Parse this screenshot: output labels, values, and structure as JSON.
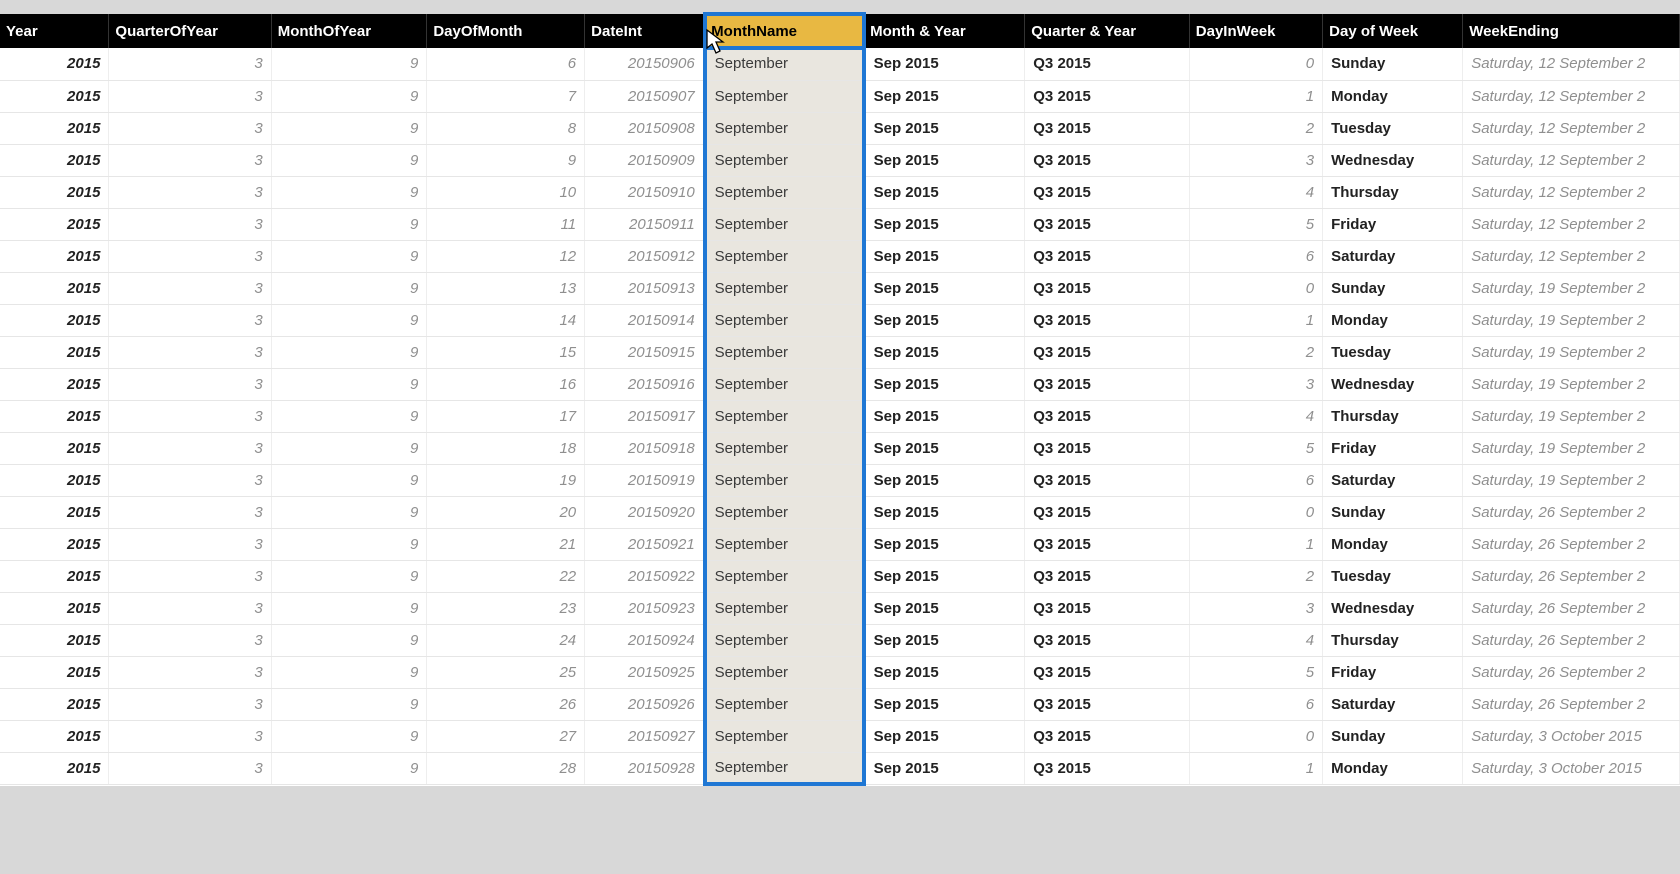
{
  "columns": [
    {
      "key": "year",
      "label": "Year"
    },
    {
      "key": "qoy",
      "label": "QuarterOfYear"
    },
    {
      "key": "moy",
      "label": "MonthOfYear"
    },
    {
      "key": "dom",
      "label": "DayOfMonth"
    },
    {
      "key": "dateint",
      "label": "DateInt"
    },
    {
      "key": "monthname",
      "label": "MonthName"
    },
    {
      "key": "monthyear",
      "label": "Month & Year"
    },
    {
      "key": "qy",
      "label": "Quarter & Year"
    },
    {
      "key": "diw",
      "label": "DayInWeek"
    },
    {
      "key": "dow",
      "label": "Day of Week"
    },
    {
      "key": "weekend",
      "label": "WeekEnding"
    }
  ],
  "selected_column": "monthname",
  "rows": [
    {
      "year": "2015",
      "qoy": "3",
      "moy": "9",
      "dom": "6",
      "dateint": "20150906",
      "monthname": "September",
      "monthyear": "Sep 2015",
      "qy": "Q3 2015",
      "diw": "0",
      "dow": "Sunday",
      "weekend": "Saturday, 12 September 2"
    },
    {
      "year": "2015",
      "qoy": "3",
      "moy": "9",
      "dom": "7",
      "dateint": "20150907",
      "monthname": "September",
      "monthyear": "Sep 2015",
      "qy": "Q3 2015",
      "diw": "1",
      "dow": "Monday",
      "weekend": "Saturday, 12 September 2"
    },
    {
      "year": "2015",
      "qoy": "3",
      "moy": "9",
      "dom": "8",
      "dateint": "20150908",
      "monthname": "September",
      "monthyear": "Sep 2015",
      "qy": "Q3 2015",
      "diw": "2",
      "dow": "Tuesday",
      "weekend": "Saturday, 12 September 2"
    },
    {
      "year": "2015",
      "qoy": "3",
      "moy": "9",
      "dom": "9",
      "dateint": "20150909",
      "monthname": "September",
      "monthyear": "Sep 2015",
      "qy": "Q3 2015",
      "diw": "3",
      "dow": "Wednesday",
      "weekend": "Saturday, 12 September 2"
    },
    {
      "year": "2015",
      "qoy": "3",
      "moy": "9",
      "dom": "10",
      "dateint": "20150910",
      "monthname": "September",
      "monthyear": "Sep 2015",
      "qy": "Q3 2015",
      "diw": "4",
      "dow": "Thursday",
      "weekend": "Saturday, 12 September 2"
    },
    {
      "year": "2015",
      "qoy": "3",
      "moy": "9",
      "dom": "11",
      "dateint": "20150911",
      "monthname": "September",
      "monthyear": "Sep 2015",
      "qy": "Q3 2015",
      "diw": "5",
      "dow": "Friday",
      "weekend": "Saturday, 12 September 2"
    },
    {
      "year": "2015",
      "qoy": "3",
      "moy": "9",
      "dom": "12",
      "dateint": "20150912",
      "monthname": "September",
      "monthyear": "Sep 2015",
      "qy": "Q3 2015",
      "diw": "6",
      "dow": "Saturday",
      "weekend": "Saturday, 12 September 2"
    },
    {
      "year": "2015",
      "qoy": "3",
      "moy": "9",
      "dom": "13",
      "dateint": "20150913",
      "monthname": "September",
      "monthyear": "Sep 2015",
      "qy": "Q3 2015",
      "diw": "0",
      "dow": "Sunday",
      "weekend": "Saturday, 19 September 2"
    },
    {
      "year": "2015",
      "qoy": "3",
      "moy": "9",
      "dom": "14",
      "dateint": "20150914",
      "monthname": "September",
      "monthyear": "Sep 2015",
      "qy": "Q3 2015",
      "diw": "1",
      "dow": "Monday",
      "weekend": "Saturday, 19 September 2"
    },
    {
      "year": "2015",
      "qoy": "3",
      "moy": "9",
      "dom": "15",
      "dateint": "20150915",
      "monthname": "September",
      "monthyear": "Sep 2015",
      "qy": "Q3 2015",
      "diw": "2",
      "dow": "Tuesday",
      "weekend": "Saturday, 19 September 2"
    },
    {
      "year": "2015",
      "qoy": "3",
      "moy": "9",
      "dom": "16",
      "dateint": "20150916",
      "monthname": "September",
      "monthyear": "Sep 2015",
      "qy": "Q3 2015",
      "diw": "3",
      "dow": "Wednesday",
      "weekend": "Saturday, 19 September 2"
    },
    {
      "year": "2015",
      "qoy": "3",
      "moy": "9",
      "dom": "17",
      "dateint": "20150917",
      "monthname": "September",
      "monthyear": "Sep 2015",
      "qy": "Q3 2015",
      "diw": "4",
      "dow": "Thursday",
      "weekend": "Saturday, 19 September 2"
    },
    {
      "year": "2015",
      "qoy": "3",
      "moy": "9",
      "dom": "18",
      "dateint": "20150918",
      "monthname": "September",
      "monthyear": "Sep 2015",
      "qy": "Q3 2015",
      "diw": "5",
      "dow": "Friday",
      "weekend": "Saturday, 19 September 2"
    },
    {
      "year": "2015",
      "qoy": "3",
      "moy": "9",
      "dom": "19",
      "dateint": "20150919",
      "monthname": "September",
      "monthyear": "Sep 2015",
      "qy": "Q3 2015",
      "diw": "6",
      "dow": "Saturday",
      "weekend": "Saturday, 19 September 2"
    },
    {
      "year": "2015",
      "qoy": "3",
      "moy": "9",
      "dom": "20",
      "dateint": "20150920",
      "monthname": "September",
      "monthyear": "Sep 2015",
      "qy": "Q3 2015",
      "diw": "0",
      "dow": "Sunday",
      "weekend": "Saturday, 26 September 2"
    },
    {
      "year": "2015",
      "qoy": "3",
      "moy": "9",
      "dom": "21",
      "dateint": "20150921",
      "monthname": "September",
      "monthyear": "Sep 2015",
      "qy": "Q3 2015",
      "diw": "1",
      "dow": "Monday",
      "weekend": "Saturday, 26 September 2"
    },
    {
      "year": "2015",
      "qoy": "3",
      "moy": "9",
      "dom": "22",
      "dateint": "20150922",
      "monthname": "September",
      "monthyear": "Sep 2015",
      "qy": "Q3 2015",
      "diw": "2",
      "dow": "Tuesday",
      "weekend": "Saturday, 26 September 2"
    },
    {
      "year": "2015",
      "qoy": "3",
      "moy": "9",
      "dom": "23",
      "dateint": "20150923",
      "monthname": "September",
      "monthyear": "Sep 2015",
      "qy": "Q3 2015",
      "diw": "3",
      "dow": "Wednesday",
      "weekend": "Saturday, 26 September 2"
    },
    {
      "year": "2015",
      "qoy": "3",
      "moy": "9",
      "dom": "24",
      "dateint": "20150924",
      "monthname": "September",
      "monthyear": "Sep 2015",
      "qy": "Q3 2015",
      "diw": "4",
      "dow": "Thursday",
      "weekend": "Saturday, 26 September 2"
    },
    {
      "year": "2015",
      "qoy": "3",
      "moy": "9",
      "dom": "25",
      "dateint": "20150925",
      "monthname": "September",
      "monthyear": "Sep 2015",
      "qy": "Q3 2015",
      "diw": "5",
      "dow": "Friday",
      "weekend": "Saturday, 26 September 2"
    },
    {
      "year": "2015",
      "qoy": "3",
      "moy": "9",
      "dom": "26",
      "dateint": "20150926",
      "monthname": "September",
      "monthyear": "Sep 2015",
      "qy": "Q3 2015",
      "diw": "6",
      "dow": "Saturday",
      "weekend": "Saturday, 26 September 2"
    },
    {
      "year": "2015",
      "qoy": "3",
      "moy": "9",
      "dom": "27",
      "dateint": "20150927",
      "monthname": "September",
      "monthyear": "Sep 2015",
      "qy": "Q3 2015",
      "diw": "0",
      "dow": "Sunday",
      "weekend": "Saturday, 3 October 2015"
    },
    {
      "year": "2015",
      "qoy": "3",
      "moy": "9",
      "dom": "28",
      "dateint": "20150928",
      "monthname": "September",
      "monthyear": "Sep 2015",
      "qy": "Q3 2015",
      "diw": "1",
      "dow": "Monday",
      "weekend": "Saturday, 3 October 2015"
    }
  ]
}
